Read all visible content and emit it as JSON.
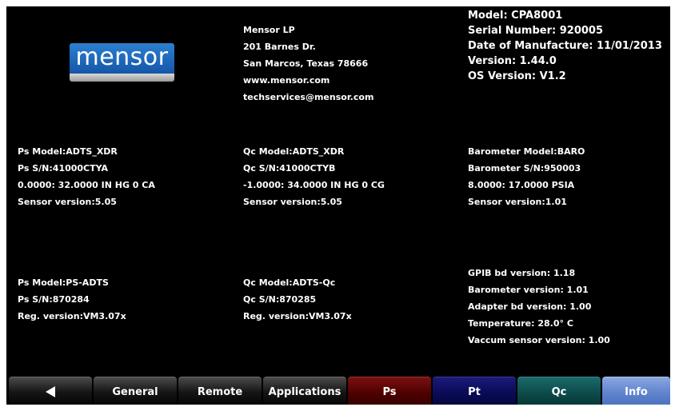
{
  "logo": {
    "text": "mensor"
  },
  "company": {
    "lines": [
      "Mensor LP",
      "201 Barnes Dr.",
      "San Marcos, Texas 78666",
      "www.mensor.com",
      "techservices@mensor.com"
    ]
  },
  "device": {
    "lines": [
      "Model: CPA8001",
      "Serial Number: 920005",
      "Date of Manufacture: 11/01/2013",
      "Version: 1.44.0",
      "OS Version: V1.2"
    ]
  },
  "ps_sensor": {
    "lines": [
      "Ps Model:ADTS_XDR",
      "Ps S/N:41000CTYA",
      "0.0000: 32.0000 IN HG 0 CA",
      "Sensor version:5.05"
    ]
  },
  "qc_sensor": {
    "lines": [
      "Qc Model:ADTS_XDR",
      "Qc S/N:41000CTYB",
      "-1.0000: 34.0000 IN HG 0 CG",
      "Sensor version:5.05"
    ]
  },
  "barometer": {
    "lines": [
      "Barometer Model:BARO",
      "Barometer S/N:950003",
      "8.0000: 17.0000 PSIA",
      "Sensor version:1.01"
    ]
  },
  "ps_regulator": {
    "lines": [
      "Ps Model:PS-ADTS",
      "Ps S/N:870284",
      "Reg. version:VM3.07x"
    ]
  },
  "qc_regulator": {
    "lines": [
      "Qc Model:ADTS-Qc",
      "Qc S/N:870285",
      "Reg. version:VM3.07x"
    ]
  },
  "system": {
    "lines": [
      "GPIB bd version:  1.18",
      "Barometer version:  1.01",
      "Adapter bd version:  1.00",
      "Temperature:    28.0° C",
      "Vaccum sensor version: 1.00"
    ]
  },
  "navbar": {
    "back_icon": "back-arrow-icon",
    "general": "General",
    "remote": "Remote",
    "applications": "Applications",
    "ps": "Ps",
    "pt": "Pt",
    "qc": "Qc",
    "info": "Info"
  },
  "colors": {
    "background": "#000000",
    "ps_tab": "#4d0000",
    "pt_tab": "#0a0a55",
    "qc_tab": "#0d4a4a",
    "info_tab_active": "#5e82cc"
  }
}
